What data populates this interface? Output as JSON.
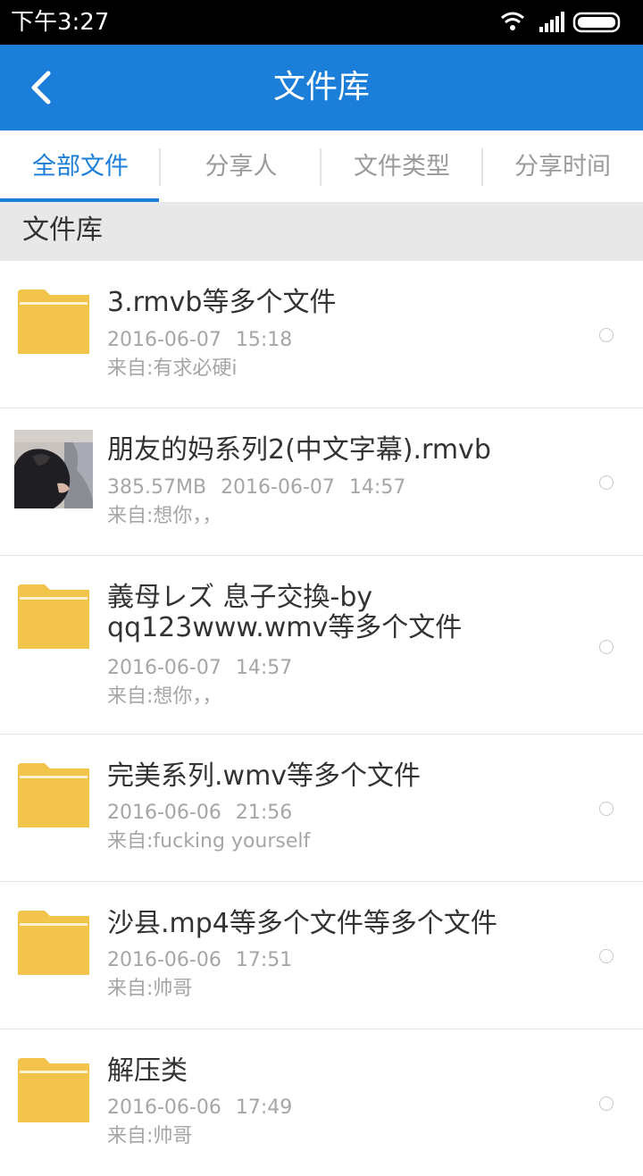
{
  "status_bar": {
    "time": "下午3:27",
    "icons": [
      "wifi-icon",
      "signal-icon",
      "battery-icon"
    ]
  },
  "app_bar": {
    "title": "文件库",
    "back_icon": "chevron-left-icon"
  },
  "tabs": [
    {
      "label": "全部文件",
      "active": true
    },
    {
      "label": "分享人",
      "active": false
    },
    {
      "label": "文件类型",
      "active": false
    },
    {
      "label": "分享时间",
      "active": false
    }
  ],
  "section": {
    "title": "文件库"
  },
  "files": [
    {
      "name": "3.rmvb等多个文件",
      "size": "",
      "date": "2016-06-07",
      "time": "15:18",
      "from": "来自:有求必硬i",
      "icon": "folder-icon"
    },
    {
      "name": "朋友的妈系列2(中文字幕).rmvb",
      "size": "385.57MB",
      "date": "2016-06-07",
      "time": "14:57",
      "from": "来自:想你，，",
      "icon": "video-thumbnail"
    },
    {
      "name": "義母レズ 息子交換-by qq123www.wmv等多个文件",
      "size": "",
      "date": "2016-06-07",
      "time": "14:57",
      "from": "来自:想你，，",
      "icon": "folder-icon"
    },
    {
      "name": "完美系列.wmv等多个文件",
      "size": "",
      "date": "2016-06-06",
      "time": "21:56",
      "from": "来自:fucking yourself",
      "icon": "folder-icon"
    },
    {
      "name": "沙县.mp4等多个文件等多个文件",
      "size": "",
      "date": "2016-06-06",
      "time": "17:51",
      "from": "来自:帅哥",
      "icon": "folder-icon"
    },
    {
      "name": "解压类",
      "size": "",
      "date": "2016-06-06",
      "time": "17:49",
      "from": "来自:帅哥",
      "icon": "folder-icon"
    }
  ],
  "colors": {
    "accent": "#1b7ed8",
    "folder": "#f2c44b",
    "status_bar": "#000000"
  }
}
